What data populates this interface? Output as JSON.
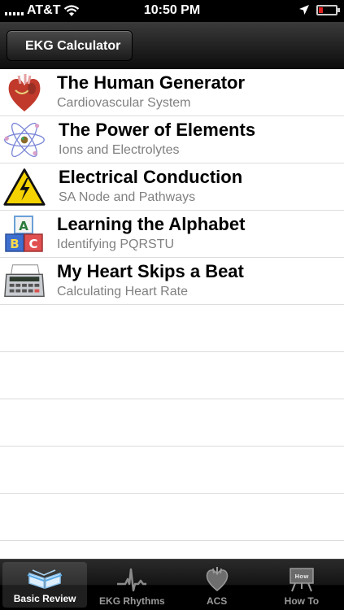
{
  "status": {
    "carrier": "AT&T",
    "time": "10:50 PM"
  },
  "nav": {
    "back_label": "EKG Calculator"
  },
  "rows": [
    {
      "title": "The Human Generator",
      "subtitle": "Cardiovascular System",
      "icon": "heart-icon"
    },
    {
      "title": "The Power of Elements",
      "subtitle": "Ions and Electrolytes",
      "icon": "atom-icon"
    },
    {
      "title": "Electrical Conduction",
      "subtitle": "SA Node and Pathways",
      "icon": "high-voltage-icon"
    },
    {
      "title": "Learning the Alphabet",
      "subtitle": "Identifying PQRSTU",
      "icon": "abc-blocks-icon"
    },
    {
      "title": "My Heart Skips a Beat",
      "subtitle": "Calculating Heart Rate",
      "icon": "calculator-icon"
    }
  ],
  "blocks_letters": [
    "A",
    "B",
    "C"
  ],
  "tabs": [
    {
      "label": "Basic Review",
      "icon": "book-icon",
      "active": true
    },
    {
      "label": "EKG Rhythms",
      "icon": "ekg-wave-icon",
      "active": false
    },
    {
      "label": "ACS",
      "icon": "heart-outline-icon",
      "active": false
    },
    {
      "label": "How To",
      "icon": "easel-icon",
      "active": false
    }
  ],
  "how_to_board_text": "How",
  "colors": {
    "accent_warning": "#f5d300",
    "heart": "#c0392b"
  }
}
